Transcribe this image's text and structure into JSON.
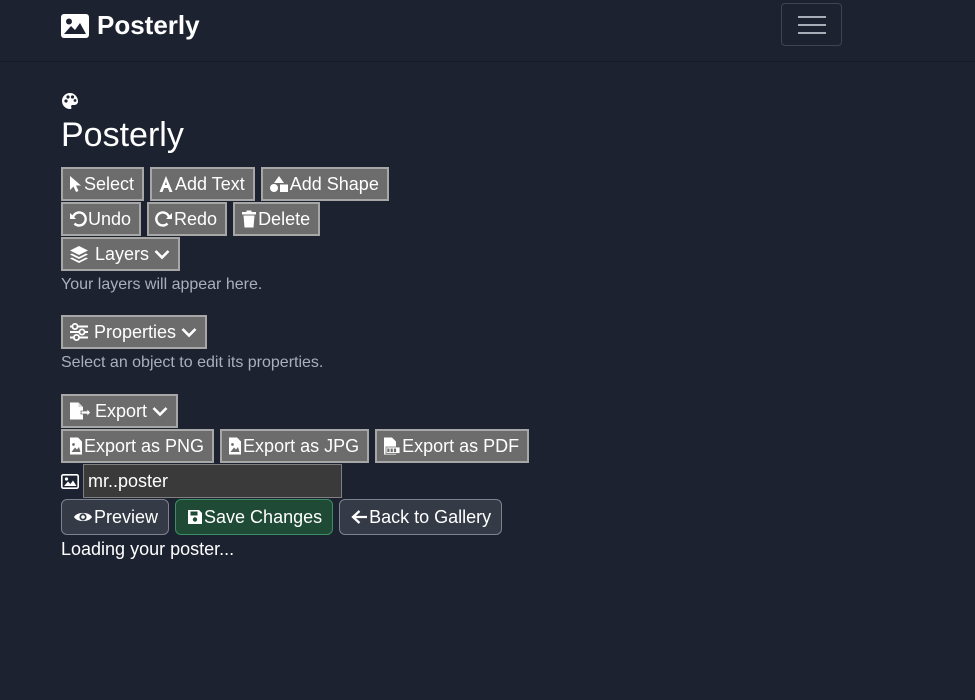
{
  "navbar": {
    "brand": "Posterly",
    "brand_icon": "image-icon",
    "menu_icon": "hamburger-icon"
  },
  "header": {
    "icon": "palette-icon",
    "title": "Posterly"
  },
  "toolbar": {
    "select": "Select",
    "add_text": "Add Text",
    "add_shape": "Add Shape",
    "undo": "Undo",
    "redo": "Redo",
    "delete": "Delete"
  },
  "layers": {
    "label": "Layers",
    "hint": "Your layers will appear here."
  },
  "properties": {
    "label": "Properties",
    "hint": "Select an object to edit its properties."
  },
  "export": {
    "label": "Export",
    "png": "Export as PNG",
    "jpg": "Export as JPG",
    "pdf": "Export as PDF"
  },
  "poster": {
    "name_value": "mr..poster"
  },
  "actions": {
    "preview": "Preview",
    "save": "Save Changes",
    "back": "Back to Gallery"
  },
  "status": {
    "loading": "Loading your poster..."
  },
  "colors": {
    "background": "#1c2230",
    "tool_button": "#6c6c6c",
    "save_button": "#1f4a35"
  }
}
